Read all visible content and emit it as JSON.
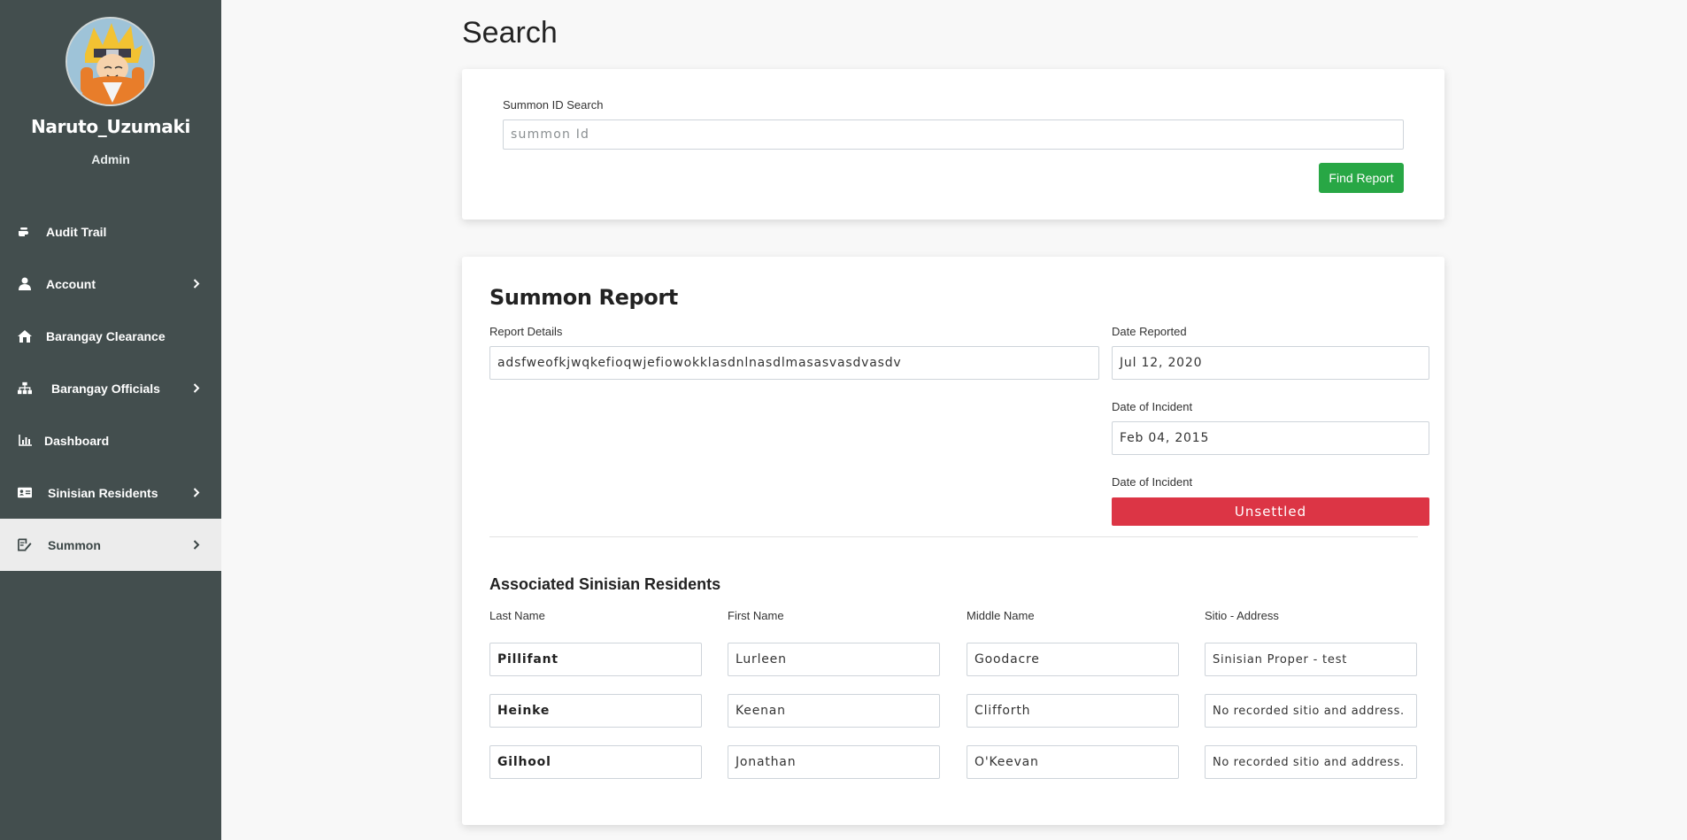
{
  "sidebar": {
    "username": "Naruto_Uzumaki",
    "role": "Admin",
    "items": [
      {
        "label": "Audit Trail",
        "icon": "hand-pointer-icon",
        "chevron": false
      },
      {
        "label": "Account",
        "icon": "user-icon",
        "chevron": true
      },
      {
        "label": "Barangay Clearance",
        "icon": "house-icon",
        "chevron": false
      },
      {
        "label": "Barangay Officials",
        "icon": "sitemap-icon",
        "chevron": true
      },
      {
        "label": "Dashboard",
        "icon": "bar-chart-icon",
        "chevron": false
      },
      {
        "label": "Sinisian Residents",
        "icon": "id-card-icon",
        "chevron": true
      },
      {
        "label": "Summon",
        "icon": "edit-document-icon",
        "chevron": true,
        "active": true
      }
    ]
  },
  "page": {
    "title": "Search"
  },
  "search": {
    "label": "Summon ID Search",
    "placeholder": "summon Id",
    "value": "",
    "button": "Find Report"
  },
  "report": {
    "title": "Summon Report",
    "details_label": "Report Details",
    "details_value": "adsfweofkjwqkefioqwjefiowokklasdnlnasdlmasasvasdvasdv",
    "date_reported_label": "Date Reported",
    "date_reported_value": "Jul 12, 2020",
    "date_incident_label": "Date of Incident",
    "date_incident_value": "Feb 04, 2015",
    "status_label": "Date of Incident",
    "status_value": "Unsettled",
    "status_color": "#dc3545"
  },
  "residents": {
    "title": "Associated Sinisian Residents",
    "headers": [
      "Last Name",
      "First Name",
      "Middle Name",
      "Sitio - Address"
    ],
    "rows": [
      [
        "Pillifant",
        "Lurleen",
        "Goodacre",
        "Sinisian Proper - test"
      ],
      [
        "Heinke",
        "Keenan",
        "Clifforth",
        "No recorded sitio and address."
      ],
      [
        "Gilhool",
        "Jonathan",
        "O'Keevan",
        "No recorded sitio and address."
      ]
    ]
  },
  "colors": {
    "sidebar_bg": "#434e4e",
    "active_item_bg": "#ececec",
    "find_button": "#28a745"
  }
}
